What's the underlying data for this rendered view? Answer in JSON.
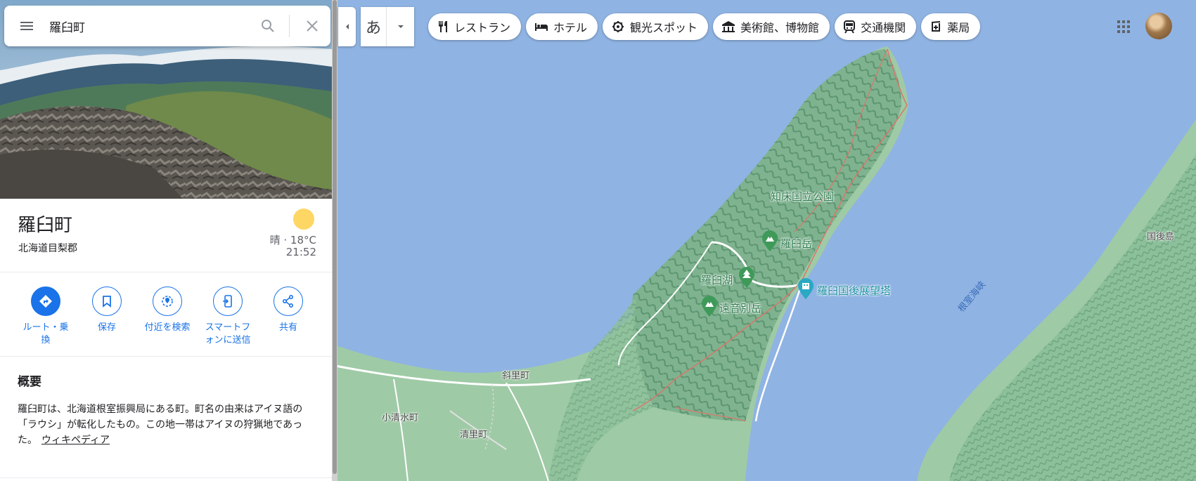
{
  "search": {
    "query": "羅臼町",
    "menu_icon": "menu-icon",
    "search_icon": "search-icon",
    "clear_icon": "close-icon"
  },
  "place": {
    "title": "羅臼町",
    "subtitle": "北海道目梨郡",
    "weather": {
      "icon": "sun-icon",
      "color": "#fdd663",
      "temp": "晴 · 18°C",
      "time": "21:52"
    }
  },
  "actions": [
    {
      "label": "ルート・乗換",
      "line1": "ルート・乗",
      "line2": "換",
      "icon": "directions-icon"
    },
    {
      "label": "保存",
      "icon": "bookmark-icon"
    },
    {
      "label": "付近を検索",
      "icon": "nearby-icon"
    },
    {
      "label": "スマートフォンに送信",
      "line1": "スマートフ",
      "line2": "ォンに送信",
      "icon": "phone-send-icon"
    },
    {
      "label": "共有",
      "icon": "share-icon"
    }
  ],
  "summary": {
    "heading": "概要",
    "text": "羅臼町は、北海道根室振興局にある町。町名の由来はアイヌ語の「ラウシ」が転化したもの。この地一帯はアイヌの狩猟地であった。",
    "link": "ウィキペディア"
  },
  "language": {
    "char": "あ"
  },
  "chips": [
    {
      "label": "レストラン",
      "icon": "restaurant-icon"
    },
    {
      "label": "ホテル",
      "icon": "hotel-icon"
    },
    {
      "label": "観光スポット",
      "icon": "attraction-icon"
    },
    {
      "label": "美術館、博物館",
      "icon": "museum-icon"
    },
    {
      "label": "交通機関",
      "icon": "transit-icon"
    },
    {
      "label": "薬局",
      "icon": "pharmacy-icon"
    }
  ],
  "map": {
    "labels": {
      "park": "知床国立公園",
      "rausu_dake": "羅臼岳",
      "rausu_ko": "羅臼湖",
      "onnebetsu": "遠音別岳",
      "tower": "羅臼国後展望塔",
      "shari": "斜里町",
      "koshimizu": "小清水町",
      "kiyosato": "清里町",
      "strait": "根室海峡",
      "kunashiri": "国後島"
    },
    "colors": {
      "sea": "#8fb3e3",
      "land": "#9fcaa6",
      "forest": "#6fa882",
      "road": "#ffffff",
      "boundary": "#d9776b"
    }
  }
}
